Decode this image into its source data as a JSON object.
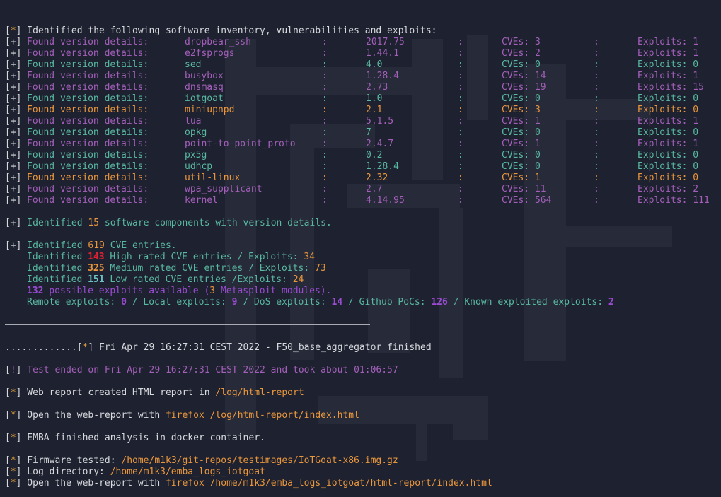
{
  "header": {
    "bracket_open": "[",
    "star": "*",
    "bracket_close": "]",
    "text": " Identified the following software inventory, vulnerabilities and exploits:"
  },
  "inventory": [
    {
      "prefix": "[+]",
      "label": "Found version details:",
      "name": "dropbear_ssh",
      "sep1": ":",
      "version": "2017.75",
      "sep2": ":",
      "cves": "CVEs: 3",
      "sep3": ":",
      "exploits": "Exploits: 1",
      "color": "#a45fba"
    },
    {
      "prefix": "[+]",
      "label": "Found version details:",
      "name": "e2fsprogs",
      "sep1": ":",
      "version": "1.44.1",
      "sep2": ":",
      "cves": "CVEs: 2",
      "sep3": ":",
      "exploits": "Exploits: 1",
      "color": "#a45fba"
    },
    {
      "prefix": "[+]",
      "label": "Found version details:",
      "name": "sed",
      "sep1": ":",
      "version": "4.0",
      "sep2": ":",
      "cves": "CVEs: 0",
      "sep3": ":",
      "exploits": "Exploits: 0",
      "color": "#59b8a1"
    },
    {
      "prefix": "[+]",
      "label": "Found version details:",
      "name": "busybox",
      "sep1": ":",
      "version": "1.28.4",
      "sep2": ":",
      "cves": "CVEs: 14",
      "sep3": ":",
      "exploits": "Exploits: 1",
      "color": "#a45fba"
    },
    {
      "prefix": "[+]",
      "label": "Found version details:",
      "name": "dnsmasq",
      "sep1": ":",
      "version": "2.73",
      "sep2": ":",
      "cves": "CVEs: 19",
      "sep3": ":",
      "exploits": "Exploits: 15",
      "color": "#a45fba"
    },
    {
      "prefix": "[+]",
      "label": "Found version details:",
      "name": "iotgoat",
      "sep1": ":",
      "version": "1.0",
      "sep2": ":",
      "cves": "CVEs: 0",
      "sep3": ":",
      "exploits": "Exploits: 0",
      "color": "#59b8a1"
    },
    {
      "prefix": "[+]",
      "label": "Found version details:",
      "name": "miniupnpd",
      "sep1": ":",
      "version": "2.1",
      "sep2": ":",
      "cves": "CVEs: 3",
      "sep3": ":",
      "exploits": "Exploits: 0",
      "color": "#e9963c"
    },
    {
      "prefix": "[+]",
      "label": "Found version details:",
      "name": "lua",
      "sep1": ":",
      "version": "5.1.5",
      "sep2": ":",
      "cves": "CVEs: 1",
      "sep3": ":",
      "exploits": "Exploits: 1",
      "color": "#a45fba"
    },
    {
      "prefix": "[+]",
      "label": "Found version details:",
      "name": "opkg",
      "sep1": ":",
      "version": "7",
      "sep2": ":",
      "cves": "CVEs: 0",
      "sep3": ":",
      "exploits": "Exploits: 0",
      "color": "#59b8a1"
    },
    {
      "prefix": "[+]",
      "label": "Found version details:",
      "name": "point-to-point_proto",
      "sep1": ":",
      "version": "2.4.7",
      "sep2": ":",
      "cves": "CVEs: 1",
      "sep3": ":",
      "exploits": "Exploits: 1",
      "color": "#a45fba"
    },
    {
      "prefix": "[+]",
      "label": "Found version details:",
      "name": "px5g",
      "sep1": ":",
      "version": "0.2",
      "sep2": ":",
      "cves": "CVEs: 0",
      "sep3": ":",
      "exploits": "Exploits: 0",
      "color": "#59b8a1"
    },
    {
      "prefix": "[+]",
      "label": "Found version details:",
      "name": "udhcp",
      "sep1": ":",
      "version": "1.28.4",
      "sep2": ":",
      "cves": "CVEs: 0",
      "sep3": ":",
      "exploits": "Exploits: 0",
      "color": "#59b8a1"
    },
    {
      "prefix": "[+]",
      "label": "Found version details:",
      "name": "util-linux",
      "sep1": ":",
      "version": "2.32",
      "sep2": ":",
      "cves": "CVEs: 1",
      "sep3": ":",
      "exploits": "Exploits: 0",
      "color": "#e9963c"
    },
    {
      "prefix": "[+]",
      "label": "Found version details:",
      "name": "wpa_supplicant",
      "sep1": ":",
      "version": "2.7",
      "sep2": ":",
      "cves": "CVEs: 11",
      "sep3": ":",
      "exploits": "Exploits: 2",
      "color": "#a45fba"
    },
    {
      "prefix": "[+]",
      "label": "Found version details:",
      "name": "kernel",
      "sep1": ":",
      "version": "4.14.95",
      "sep2": ":",
      "cves": "CVEs: 564",
      "sep3": ":",
      "exploits": "Exploits: 111",
      "color": "#a45fba"
    }
  ],
  "summary": {
    "components": {
      "prefix": "[+]",
      "t1": " Identified ",
      "count": "15",
      "t2": " software components with version details."
    },
    "cve_total": {
      "prefix": "[+]",
      "t1": " Identified ",
      "count": "619",
      "t2": " CVE entries."
    },
    "high": {
      "t1": "Identified ",
      "count": "143",
      "t2": " High rated CVE entries / Exploits: ",
      "exploits": "34"
    },
    "medium": {
      "t1": "Identified ",
      "count": "325",
      "t2": " Medium rated CVE entries / Exploits: ",
      "exploits": "73"
    },
    "low": {
      "t1": "Identified ",
      "count": "151",
      "t2": " Low rated CVE entries /Exploits: ",
      "exploits": "24"
    },
    "possible": {
      "count": "132",
      "t1": " possible exploits available (",
      "msf": "3",
      "t2": " Metasploit modules)."
    },
    "remote": {
      "t1": "Remote exploits: ",
      "remote": "0",
      "t2": " / Local exploits: ",
      "local": "9",
      "t3": " / DoS exploits: ",
      "dos": "14",
      "t4": " / Github PoCs: ",
      "github": "126",
      "t5": " / Known exploited exploits: ",
      "known": "2"
    }
  },
  "finish": {
    "dots": ".............",
    "bracket_open": "[",
    "star": "*",
    "bracket_close": "]",
    "text": " Fri Apr 29 16:27:31 CEST 2022 - F50_base_aggregator finished"
  },
  "test_ended": {
    "bo": "[",
    "bang": "!",
    "bc": "]",
    "text": " Test ended on Fri Apr 29 16:27:31 CEST 2022 and took about 01:06:57"
  },
  "web_report": {
    "bo": "[",
    "star": "*",
    "bc": "]",
    "text": " Web report created HTML report in ",
    "path": "/log/html-report"
  },
  "open_report1": {
    "bo": "[",
    "star": "*",
    "bc": "]",
    "text": " Open the web-report with ",
    "cmd": "firefox",
    "path": " /log/html-report/index.html"
  },
  "emba_done": {
    "bo": "[",
    "star": "*",
    "bc": "]",
    "text": " EMBA finished analysis in docker container."
  },
  "firmware": {
    "bo": "[",
    "star": "*",
    "bc": "]",
    "text": " Firmware tested: ",
    "path": "/home/m1k3/git-repos/testimages/IoTGoat-x86.img.gz"
  },
  "logdir": {
    "bo": "[",
    "star": "*",
    "bc": "]",
    "text": " Log directory: ",
    "path": "/home/m1k3/emba_logs_iotgoat"
  },
  "open_report2": {
    "bo": "[",
    "star": "*",
    "bc": "]",
    "text": " Open the web-report with ",
    "cmd": "firefox",
    "path": " /home/m1k3/emba_logs_iotgoat/html-report/index.html"
  },
  "colors": {
    "background": "#1e2230",
    "white": "#d8d9de",
    "yellow": "#e8a13a",
    "green": "#59b8a1",
    "magenta": "#a45fba",
    "orange": "#e9963c",
    "red": "#e02131",
    "purple": "#9a4bd1"
  }
}
